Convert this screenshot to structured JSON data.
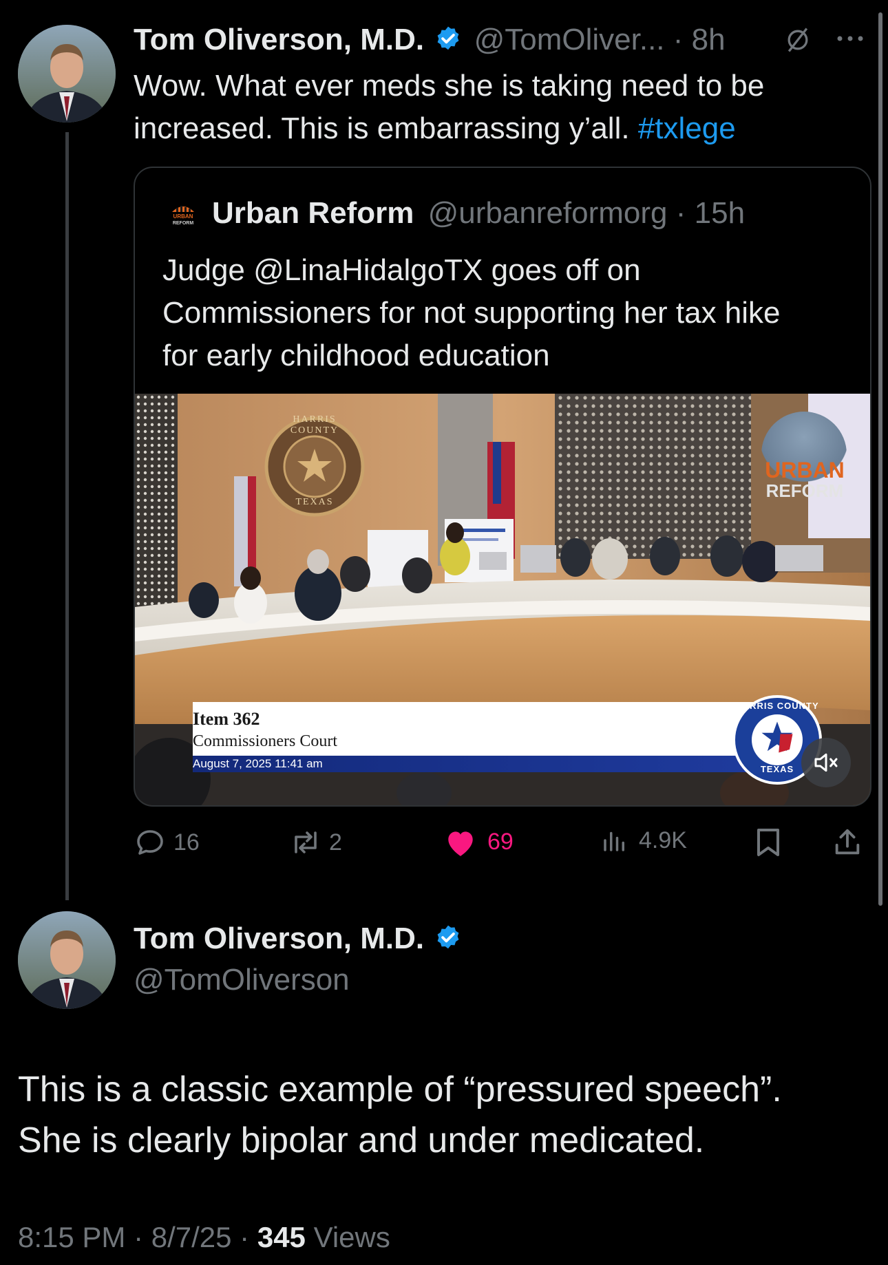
{
  "parent_tweet": {
    "author_name": "Tom Oliverson, M.D.",
    "handle_time": "@TomOliver... · 8h",
    "text_main": "Wow.  What ever meds she is taking need to be increased.  This is embarrassing y’all. ",
    "hashtag": "#txlege",
    "avatar_icon": "avatar-photo",
    "more_icon": "more-options-icon",
    "hide_icon": "hidden-reply-icon"
  },
  "quoted_tweet": {
    "author_name": "Urban Reform",
    "handle_time": "@urbanreformorg · 15h",
    "text": "Judge @LinaHidalgoTX goes off on Commissioners for not supporting her tax hike for early childhood education",
    "avatar_label": "URBAN REFORM",
    "video": {
      "seal_text_top": "HARRIS COUNTY",
      "seal_text_bottom": "TEXAS",
      "watermark_line1": "URBAN",
      "watermark_line2": "REFORM",
      "lower_third_title": "Item 362",
      "lower_third_subtitle": "Commissioners Court",
      "lower_third_date": "August 7, 2025 11:41 am",
      "logo_text_top": "HARRIS COUNTY",
      "logo_text_bottom": "TEXAS",
      "mute_icon": "muted-speaker-icon"
    }
  },
  "actions": {
    "replies": "16",
    "reposts": "2",
    "likes": "69",
    "views": "4.9K",
    "like_color": "#f91880"
  },
  "main_tweet": {
    "author_name": "Tom Oliverson, M.D.",
    "handle": "@TomOliverson",
    "text_line1": "This is a classic example of “pressured speech”.",
    "text_line2": "She is clearly bipolar and under medicated.",
    "time": "8:15 PM · 8/7/25 · ",
    "views_count": "345",
    "views_label": " Views"
  },
  "colors": {
    "accent": "#1d9bf0",
    "background": "#000000",
    "muted": "#71767b"
  }
}
